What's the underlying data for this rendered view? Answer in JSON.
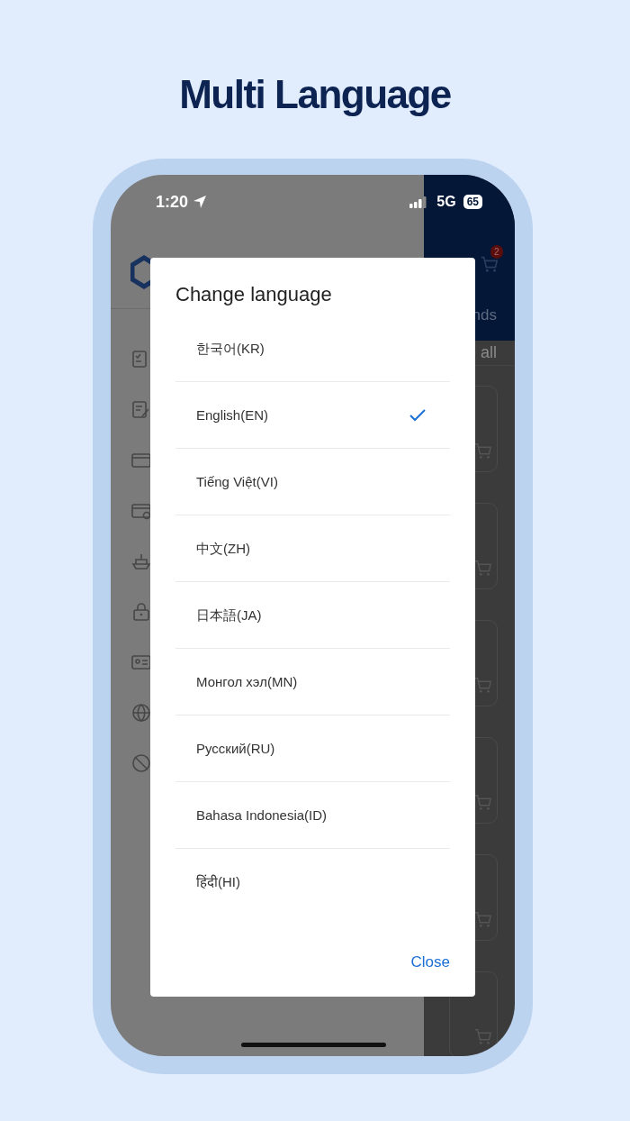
{
  "heading": "Multi Language",
  "status_bar": {
    "time": "1:20",
    "network": "5G",
    "battery": "65"
  },
  "background": {
    "cart_badge": "2",
    "tab_label": "nds",
    "link_label": "all"
  },
  "dialog": {
    "title": "Change language",
    "options": [
      {
        "label": "한국어(KR)",
        "selected": false
      },
      {
        "label": "English(EN)",
        "selected": true
      },
      {
        "label": "Tiếng Việt(VI)",
        "selected": false
      },
      {
        "label": "中文(ZH)",
        "selected": false
      },
      {
        "label": "日本語(JA)",
        "selected": false
      },
      {
        "label": "Монгол хэл(MN)",
        "selected": false
      },
      {
        "label": "Русский(RU)",
        "selected": false
      },
      {
        "label": "Bahasa Indonesia(ID)",
        "selected": false
      },
      {
        "label": "हिंदी(HI)",
        "selected": false
      }
    ],
    "close": "Close"
  }
}
